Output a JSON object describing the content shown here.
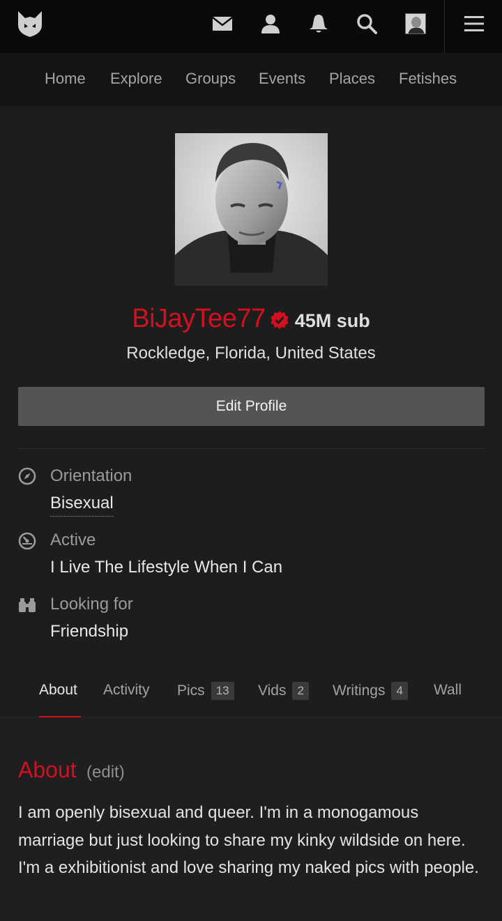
{
  "colors": {
    "accent": "#d5101e",
    "topbar": "#0a0a0a",
    "navbar": "#141414",
    "background": "#1d1d1e",
    "button": "#545457"
  },
  "topbar": {
    "icons": [
      "fetlife-logo-icon",
      "mail-icon",
      "profile-icon",
      "notifications-bell-icon",
      "search-icon",
      "avatar-thumbnail",
      "hamburger-menu-icon"
    ]
  },
  "nav": {
    "items": [
      "Home",
      "Explore",
      "Groups",
      "Events",
      "Places",
      "Fetishes"
    ]
  },
  "profile": {
    "username": "BiJayTee77",
    "verified_icon": "verified-badge-icon",
    "tag": "45M sub",
    "location": "Rockledge, Florida, United States",
    "edit_label": "Edit Profile"
  },
  "info": [
    {
      "icon": "compass-icon",
      "label": "Orientation",
      "value": "Bisexual"
    },
    {
      "icon": "gauge-icon",
      "label": "Active",
      "value": "I Live The Lifestyle When I Can"
    },
    {
      "icon": "binoculars-icon",
      "label": "Looking for",
      "value": "Friendship"
    }
  ],
  "tabs": [
    {
      "label": "About",
      "count": null,
      "active": true
    },
    {
      "label": "Activity",
      "count": null,
      "active": false
    },
    {
      "label": "Pics",
      "count": "13",
      "active": false
    },
    {
      "label": "Vids",
      "count": "2",
      "active": false
    },
    {
      "label": "Writings",
      "count": "4",
      "active": false
    },
    {
      "label": "Wall",
      "count": null,
      "active": false
    }
  ],
  "about": {
    "heading": "About",
    "edit": "(edit)",
    "text": "I am openly bisexual and queer. I'm in a monogamous marriage but just looking to share my kinky wildside on here. I'm a exhibitionist and love sharing my naked pics with people."
  }
}
